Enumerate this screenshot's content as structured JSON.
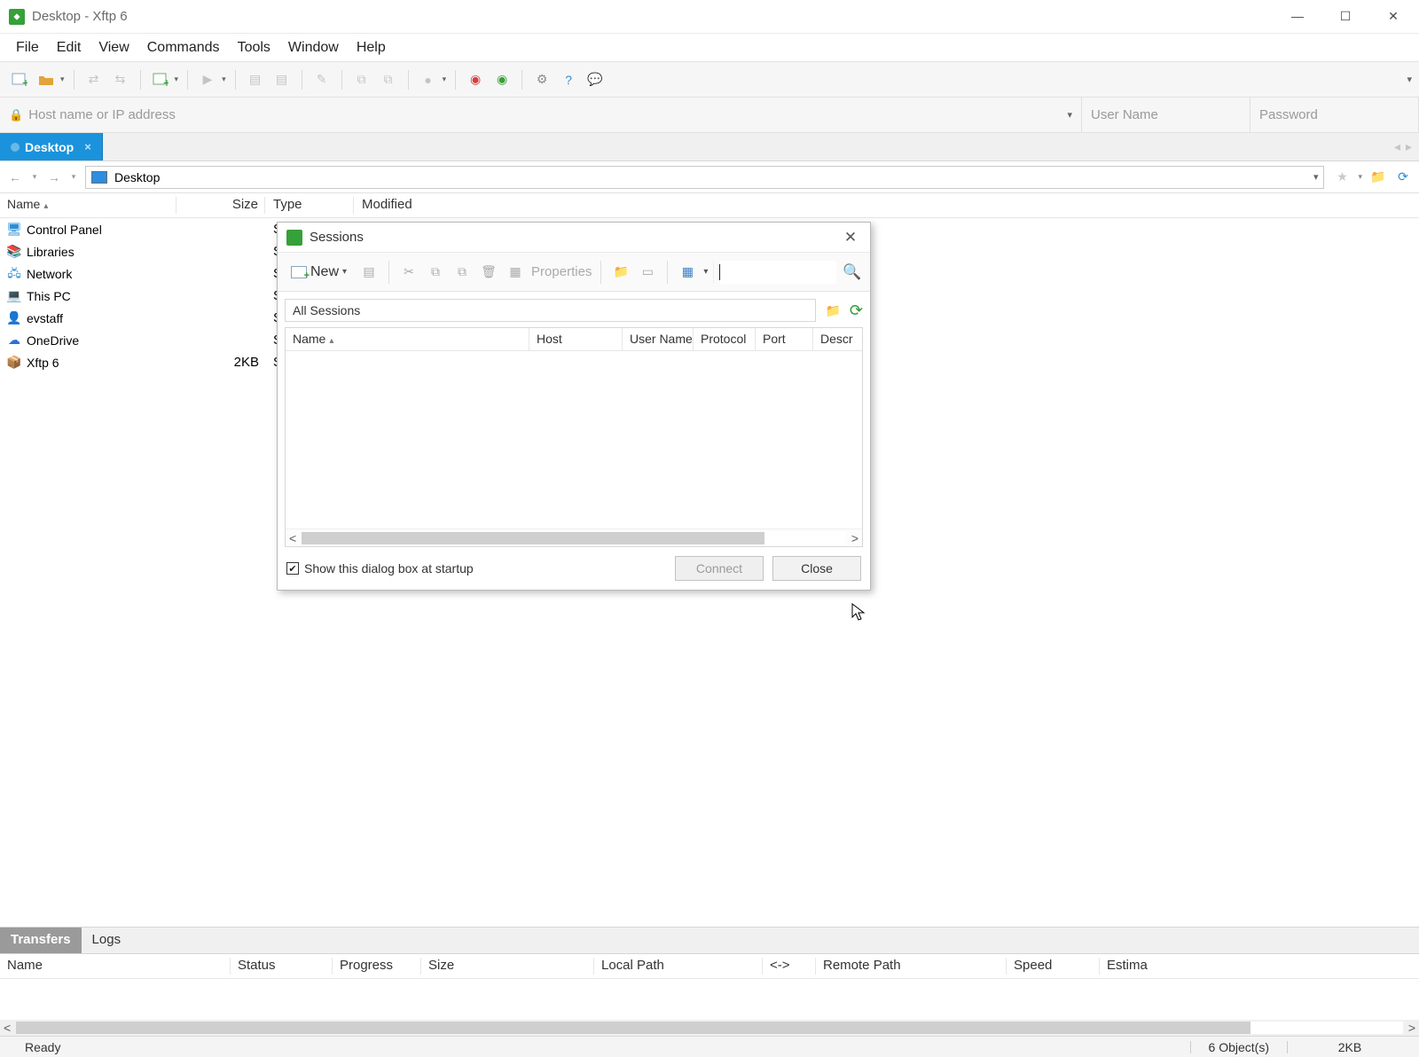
{
  "window": {
    "title": "Desktop - Xftp 6"
  },
  "menu": [
    "File",
    "Edit",
    "View",
    "Commands",
    "Tools",
    "Window",
    "Help"
  ],
  "address": {
    "host_placeholder": "Host name or IP address",
    "user_placeholder": "User Name",
    "pass_placeholder": "Password"
  },
  "tab": {
    "label": "Desktop"
  },
  "path": {
    "value": "Desktop"
  },
  "filelist": {
    "cols": {
      "name": "Name",
      "size": "Size",
      "type": "Type",
      "modified": "Modified"
    },
    "rows": [
      {
        "name": "Control Panel",
        "size": "",
        "type": "S",
        "mod": "",
        "icon": "cp"
      },
      {
        "name": "Libraries",
        "size": "",
        "type": "S",
        "mod": "",
        "icon": "lib"
      },
      {
        "name": "Network",
        "size": "",
        "type": "S",
        "mod": "",
        "icon": "net"
      },
      {
        "name": "This PC",
        "size": "",
        "type": "S",
        "mod": "",
        "icon": "pc"
      },
      {
        "name": "evstaff",
        "size": "",
        "type": "S",
        "mod": "",
        "icon": "user"
      },
      {
        "name": "OneDrive",
        "size": "",
        "type": "S",
        "mod": "",
        "icon": "cloud"
      },
      {
        "name": "Xftp 6",
        "size": "2KB",
        "type": "S",
        "mod": "",
        "icon": "app"
      }
    ]
  },
  "transfers": {
    "tabs": {
      "transfers": "Transfers",
      "logs": "Logs"
    },
    "cols": {
      "name": "Name",
      "status": "Status",
      "progress": "Progress",
      "size": "Size",
      "local": "Local Path",
      "arrow": "<->",
      "remote": "Remote Path",
      "speed": "Speed",
      "est": "Estima"
    }
  },
  "status": {
    "ready": "Ready",
    "objects": "6 Object(s)",
    "size": "2KB"
  },
  "dialog": {
    "title": "Sessions",
    "new_label": "New",
    "properties_label": "Properties",
    "crumb": "All Sessions",
    "cols": {
      "name": "Name",
      "host": "Host",
      "user": "User Name",
      "proto": "Protocol",
      "port": "Port",
      "desc": "Descr"
    },
    "show_startup": "Show this dialog box at startup",
    "connect": "Connect",
    "close": "Close"
  }
}
